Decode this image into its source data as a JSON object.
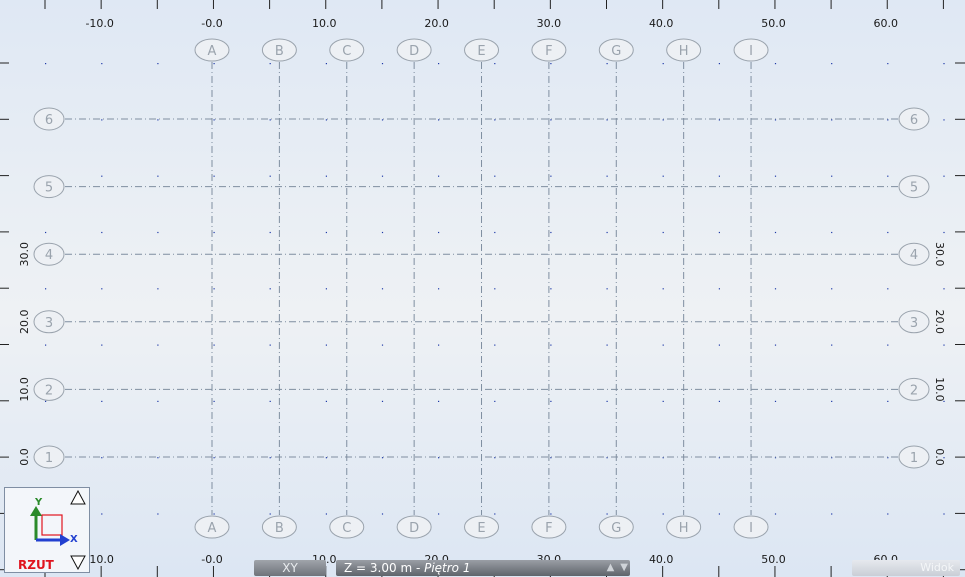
{
  "rulers": {
    "x_labels": [
      "-10.0",
      "-0.0",
      "10.0",
      "20.0",
      "30.0",
      "40.0",
      "50.0",
      "60.0"
    ],
    "y_labels": [
      "30.0",
      "20.0",
      "10.0",
      "0.0"
    ]
  },
  "grid": {
    "columns": [
      "A",
      "B",
      "C",
      "D",
      "E",
      "F",
      "G",
      "H",
      "I"
    ],
    "rows": [
      "6",
      "5",
      "4",
      "3",
      "2",
      "1"
    ]
  },
  "nav_cube": {
    "y_axis": "Y",
    "x_axis": "X",
    "view_label": "RZUT",
    "up_icon": "triangle-up-icon",
    "down_icon": "triangle-down-icon"
  },
  "status": {
    "view": "XY",
    "level_prefix": "Z = 3.00 m - ",
    "level_name": "Piętro 1",
    "corner": "Widok"
  },
  "colors": {
    "grid_line": "#7f8ea0",
    "grid_label": "#9aa3ad",
    "ruler_text": "#1a1a1a",
    "dot": "#1f3aa8",
    "axis_y": "#2a8a2a",
    "axis_x": "#2240d0",
    "view_label": "#e0141e"
  }
}
